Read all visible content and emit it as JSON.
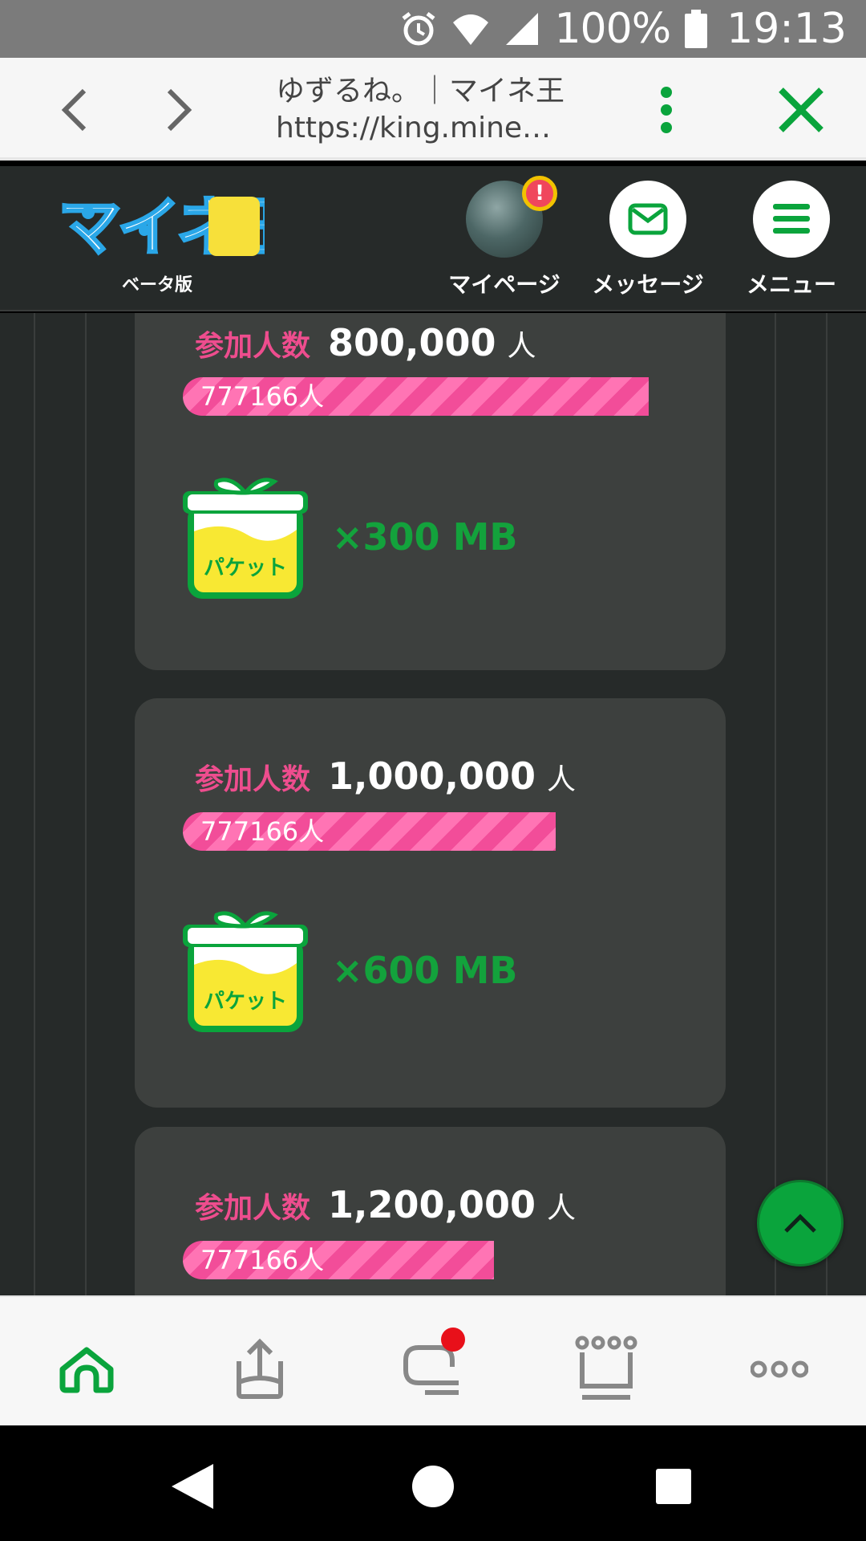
{
  "status_bar": {
    "battery_percent": "100%",
    "time": "19:13"
  },
  "browser": {
    "page_title": "ゆずるね。｜マイネ王",
    "page_url": "https://king.mine…"
  },
  "site_header": {
    "logo_text": "マイネ王",
    "logo_sub": "ベータ版",
    "mypage_label": "マイページ",
    "messages_label": "メッセージ",
    "menu_label": "メニュー",
    "alert_badge": "!"
  },
  "cards": [
    {
      "count_label": "参加人数",
      "target": "800,000",
      "unit": "人",
      "progress_text": "777166人",
      "progress_ratio": 0.971,
      "gift_label": "パケット",
      "reward": "×300 MB"
    },
    {
      "count_label": "参加人数",
      "target": "1,000,000",
      "unit": "人",
      "progress_text": "777166人",
      "progress_ratio": 0.777,
      "gift_label": "パケット",
      "reward": "×600 MB"
    },
    {
      "count_label": "参加人数",
      "target": "1,200,000",
      "unit": "人",
      "progress_text": "777166人",
      "progress_ratio": 0.648
    }
  ],
  "tabbar": {
    "items": [
      "home-icon",
      "upload-icon",
      "chat-icon",
      "crown-icon",
      "more-icon"
    ],
    "active": "home-icon",
    "accent": "#0aa43c"
  },
  "colors": {
    "pink": "#ee4d8e",
    "green": "#13a23c",
    "card_bg": "#3d403e",
    "page_bg": "#262a29"
  }
}
